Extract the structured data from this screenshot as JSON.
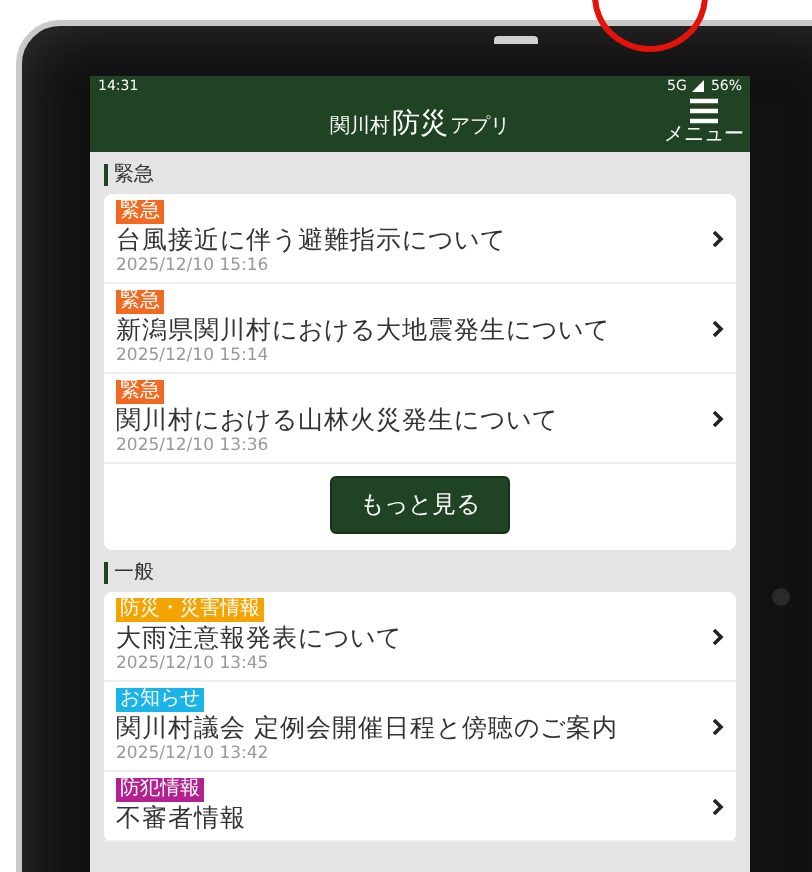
{
  "status_bar": {
    "time": "14:31",
    "network": "5G",
    "battery": "56%"
  },
  "header": {
    "title_small": "関川村",
    "title_large": "防災",
    "title_suffix": "アプリ",
    "menu_label": "メニュー"
  },
  "sections": [
    {
      "title": "緊急",
      "items": [
        {
          "tag": "緊急",
          "color": "#f26a21",
          "title": "台風接近に伴う避難指示について",
          "date": "2025/12/10 15:16"
        },
        {
          "tag": "緊急",
          "color": "#f26a21",
          "title": "新潟県関川村における大地震発生について",
          "date": "2025/12/10 15:14"
        },
        {
          "tag": "緊急",
          "color": "#f26a21",
          "title": "関川村における山林火災発生について",
          "date": "2025/12/10 13:36"
        }
      ],
      "more_button": "もっと見る"
    },
    {
      "title": "一般",
      "items": [
        {
          "tag": "防災・災害情報",
          "color": "#f5a300",
          "title": "大雨注意報発表について",
          "date": "2025/12/10 13:45"
        },
        {
          "tag": "お知らせ",
          "color": "#1ab4e8",
          "title": "関川村議会 定例会開催日程と傍聴のご案内",
          "date": "2025/12/10 13:42"
        },
        {
          "tag": "防犯情報",
          "color": "#b3208f",
          "title": "不審者情報"
        }
      ]
    }
  ]
}
